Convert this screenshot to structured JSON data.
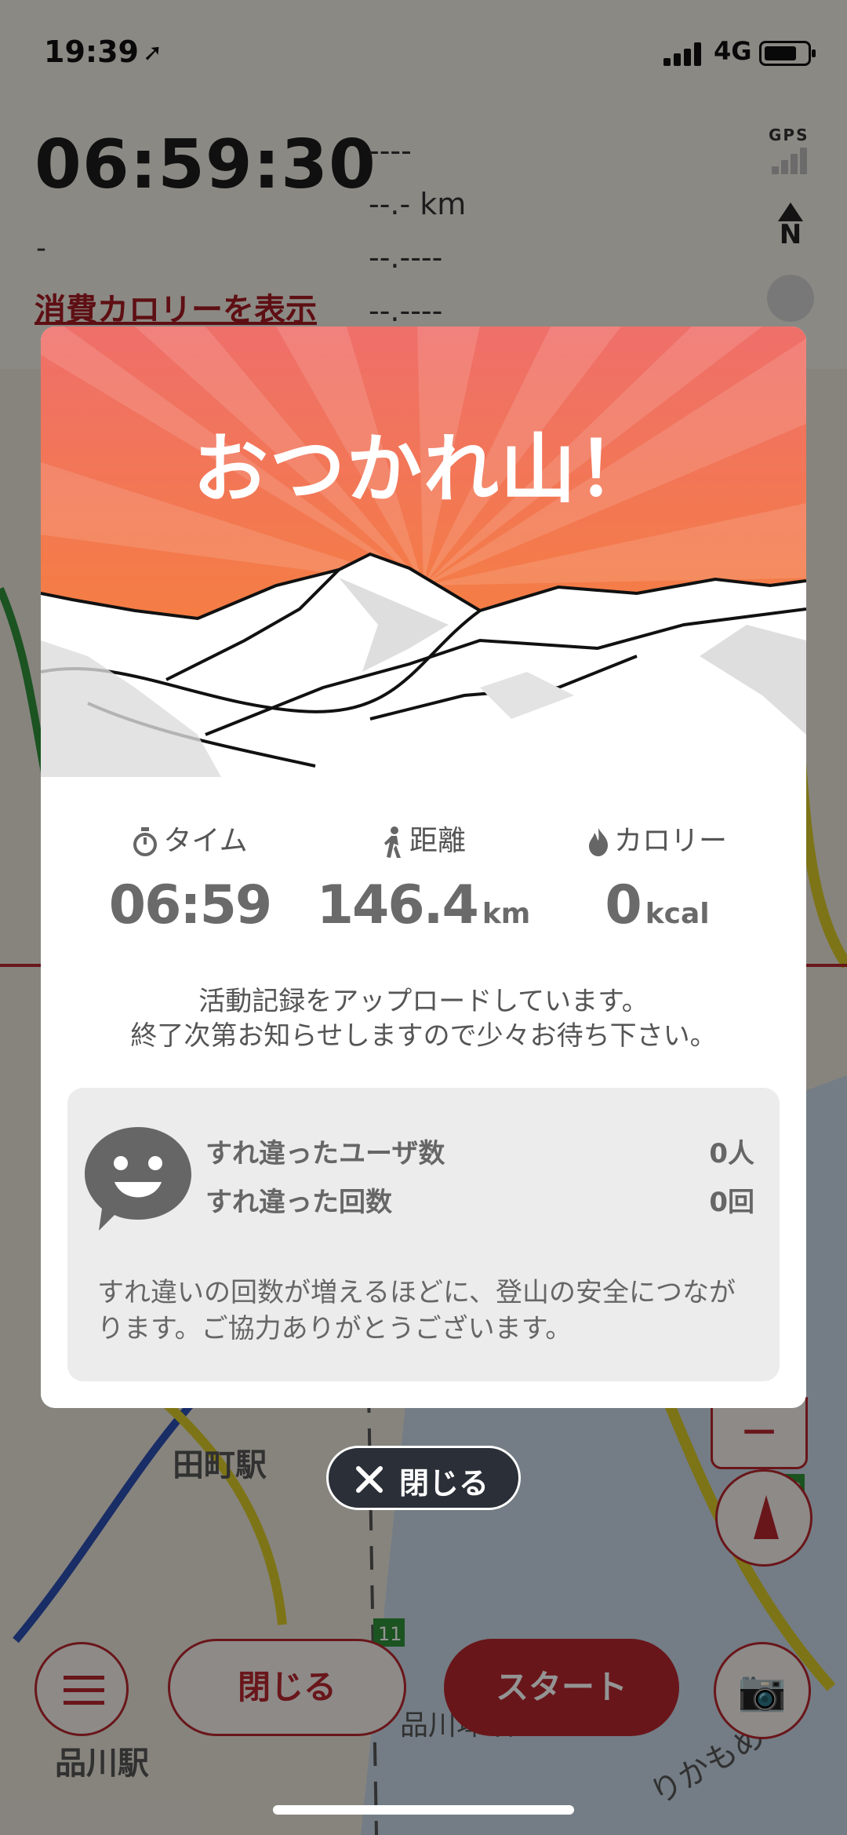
{
  "status_bar": {
    "time": "19:39",
    "location_glyph": "➚",
    "network": "4G"
  },
  "tracker": {
    "elapsed": "06:59:30",
    "sub_dash": "-",
    "calorie_link": "消費カロリーを表示",
    "readouts": [
      "----",
      "--.- km",
      "--.----",
      "--.----"
    ],
    "gps_label": "GPS",
    "compass_label": "N"
  },
  "bottom_bar": {
    "close_label": "閉じる",
    "start_label": "スタート",
    "camera_glyph": "📷"
  },
  "modal": {
    "title": "おつかれ山！",
    "stats": [
      {
        "label": "タイム",
        "icon": "stopwatch-icon",
        "value": "06:59",
        "unit": ""
      },
      {
        "label": "距離",
        "icon": "walker-icon",
        "value": "146.4",
        "unit": "km"
      },
      {
        "label": "カロリー",
        "icon": "flame-icon",
        "value": "0",
        "unit": "kcal"
      }
    ],
    "upload_line1": "活動記録をアップロードしています。",
    "upload_line2": "終了次第お知らせしますので少々お待ち下さい。",
    "pass_users_label": "すれ違ったユーザ数",
    "pass_users_value": "0人",
    "pass_count_label": "すれ違った回数",
    "pass_count_value": "0回",
    "pass_note": "すれ違いの回数が増えるほどに、登山の安全につながります。ご協力ありがとうございます。",
    "close_label": "閉じる"
  },
  "map_labels": {
    "station1": "田町駅",
    "station2": "品川駅",
    "area": "品川埠頭",
    "route": "10",
    "route2": "11",
    "yurikamome": "りかもめ"
  },
  "colors": {
    "accent": "#b5262e",
    "hero_top": "#ef6f5e",
    "hero_bottom": "#f58a3a",
    "overlay": "rgba(0,0,0,0.42)"
  }
}
